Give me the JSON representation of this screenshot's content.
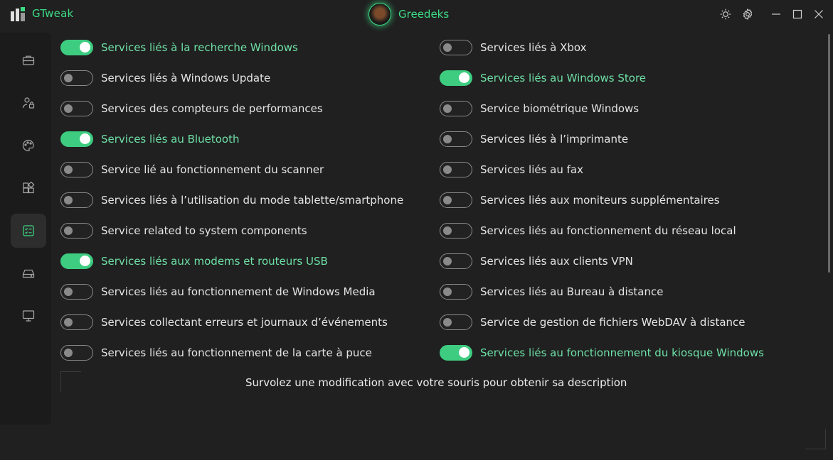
{
  "app": {
    "title": "GTweak",
    "user": "Greedeks",
    "accent": "#3ddc84"
  },
  "titlebar_icons": [
    "sun-icon",
    "gear-icon",
    "minimize-icon",
    "maximize-icon",
    "close-icon"
  ],
  "sidebar": {
    "items": [
      {
        "icon": "briefcase-icon",
        "active": false
      },
      {
        "icon": "user-lock-icon",
        "active": false
      },
      {
        "icon": "palette-icon",
        "active": false
      },
      {
        "icon": "apps-icon",
        "active": false
      },
      {
        "icon": "checklist-icon",
        "active": true
      },
      {
        "icon": "drive-icon",
        "active": false
      },
      {
        "icon": "monitor-icon",
        "active": false
      }
    ]
  },
  "left_column": [
    {
      "label": "Services liés à la recherche Windows",
      "on": true
    },
    {
      "label": "Services liés à Windows Update",
      "on": false
    },
    {
      "label": "Services des compteurs de performances",
      "on": false
    },
    {
      "label": "Services liés au Bluetooth",
      "on": true
    },
    {
      "label": "Service lié au fonctionnement du scanner",
      "on": false
    },
    {
      "label": "Services liés à l’utilisation du mode tablette/smartphone",
      "on": false
    },
    {
      "label": "Service related to system components",
      "on": false
    },
    {
      "label": "Services liés aux modems et routeurs USB",
      "on": true
    },
    {
      "label": "Services liés au fonctionnement de Windows Media",
      "on": false
    },
    {
      "label": "Services collectant erreurs et journaux d’événements",
      "on": false
    },
    {
      "label": "Services liés au fonctionnement de la carte à puce",
      "on": false
    }
  ],
  "right_column": [
    {
      "label": "Services liés à Xbox",
      "on": false
    },
    {
      "label": "Services liés au Windows Store",
      "on": true
    },
    {
      "label": "Service biométrique Windows",
      "on": false
    },
    {
      "label": "Services liés à l’imprimante",
      "on": false
    },
    {
      "label": "Services liés au fax",
      "on": false
    },
    {
      "label": "Services liés aux moniteurs supplémentaires",
      "on": false
    },
    {
      "label": "Services liés au fonctionnement du réseau local",
      "on": false
    },
    {
      "label": "Services liés aux clients VPN",
      "on": false
    },
    {
      "label": "Services liés au Bureau à distance",
      "on": false
    },
    {
      "label": "Service de gestion de fichiers WebDAV à distance",
      "on": false
    },
    {
      "label": "Services liés au fonctionnement du kiosque Windows",
      "on": true
    }
  ],
  "description": "Survolez une modification avec votre souris pour obtenir sa description"
}
